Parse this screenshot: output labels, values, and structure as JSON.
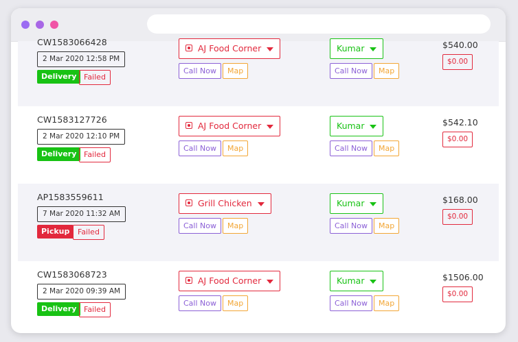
{
  "orders": [
    {
      "id": "CW1583066428",
      "time": "2 Mar 2020 12:58 PM",
      "type": "Delivery",
      "status": "Failed",
      "restaurant": "AJ Food Corner",
      "driver": "Kumar",
      "call_label": "Call Now",
      "map_label": "Map",
      "amount": "$540.00",
      "tip": "$0.00"
    },
    {
      "id": "CW1583127726",
      "time": "2 Mar 2020 12:10 PM",
      "type": "Delivery",
      "status": "Failed",
      "restaurant": "AJ Food Corner",
      "driver": "Kumar",
      "call_label": "Call Now",
      "map_label": "Map",
      "amount": "$542.10",
      "tip": "$0.00"
    },
    {
      "id": "AP1583559611",
      "time": "7 Mar 2020 11:32 AM",
      "type": "Pickup",
      "status": "Failed",
      "restaurant": "Grill Chicken",
      "driver": "Kumar",
      "call_label": "Call Now",
      "map_label": "Map",
      "amount": "$168.00",
      "tip": "$0.00"
    },
    {
      "id": "CW1583068723",
      "time": "2 Mar 2020 09:39 AM",
      "type": "Delivery",
      "status": "Failed",
      "restaurant": "AJ Food Corner",
      "driver": "Kumar",
      "call_label": "Call Now",
      "map_label": "Map",
      "amount": "$1506.00",
      "tip": "$0.00"
    }
  ]
}
